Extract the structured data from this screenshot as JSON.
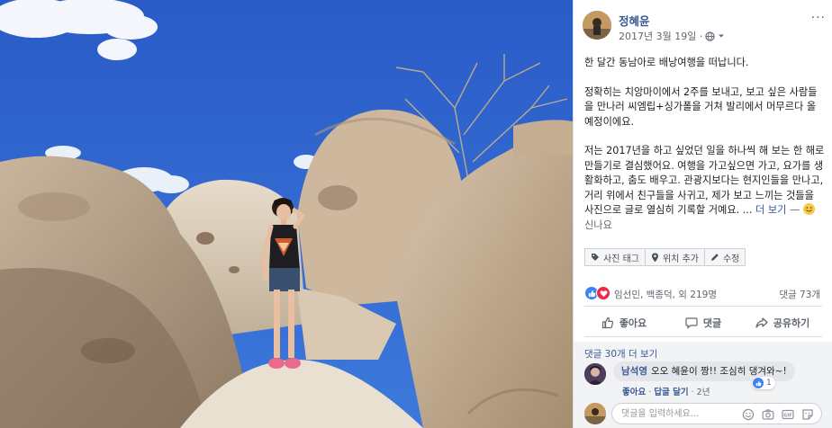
{
  "post": {
    "author": "정혜윤",
    "date": "2017년 3월 19일 · ",
    "privacy_icon": "globe-icon",
    "more_label": "···",
    "body": {
      "p1": "한 달간 동남아로 배낭여행을 떠납니다.",
      "p2": "정확히는 치앙마이에서 2주를 보내고, 보고 싶은 사람들을 만나러 씨엠립+싱가폴을 거쳐 발리에서 머무르다 올 예정이에요.",
      "p3": "저는 2017년을 하고 싶었던 일을 하나씩 해 보는 한 해로 만들기로 결심했어요. 여행을 가고싶으면 가고, 요가를 생활화하고, 춤도 배우고. 관광지보다는 현지인들을 만나고, 거리 위에서 친구들을 사귀고, 제가 보고 느끼는 것들을 사진으로 글로 열심히 기록할 거예요. ...",
      "see_more": "더 보기",
      "feeling_dash": " — ",
      "feeling": "신나요"
    },
    "tag_buttons": [
      {
        "label": "사진 태그",
        "icon": "tag-icon"
      },
      {
        "label": "위치 추가",
        "icon": "location-pin-icon"
      },
      {
        "label": "수정",
        "icon": "pencil-icon"
      }
    ],
    "reactions": {
      "names": "임선민, 백종덕, 외 219명",
      "comment_count": "댓글 73개"
    },
    "actions": {
      "like": "좋아요",
      "comment": "댓글",
      "share": "공유하기"
    }
  },
  "comments": {
    "previous_link": "댓글 30개 더 보기",
    "items": [
      {
        "name": "남석영",
        "text": "오오 혜윤이 짱!! 조심히 댕겨와~!",
        "reaction_count": "1",
        "like_label": "좋아요",
        "reply_label": "답글 달기",
        "time": "2년"
      }
    ],
    "composer_placeholder": "댓글을 입력하세요..."
  },
  "colors": {
    "link_blue": "#385898",
    "like_blue": "#3b83f6",
    "love_red": "#f0284a",
    "sky": "#2f63c8"
  }
}
